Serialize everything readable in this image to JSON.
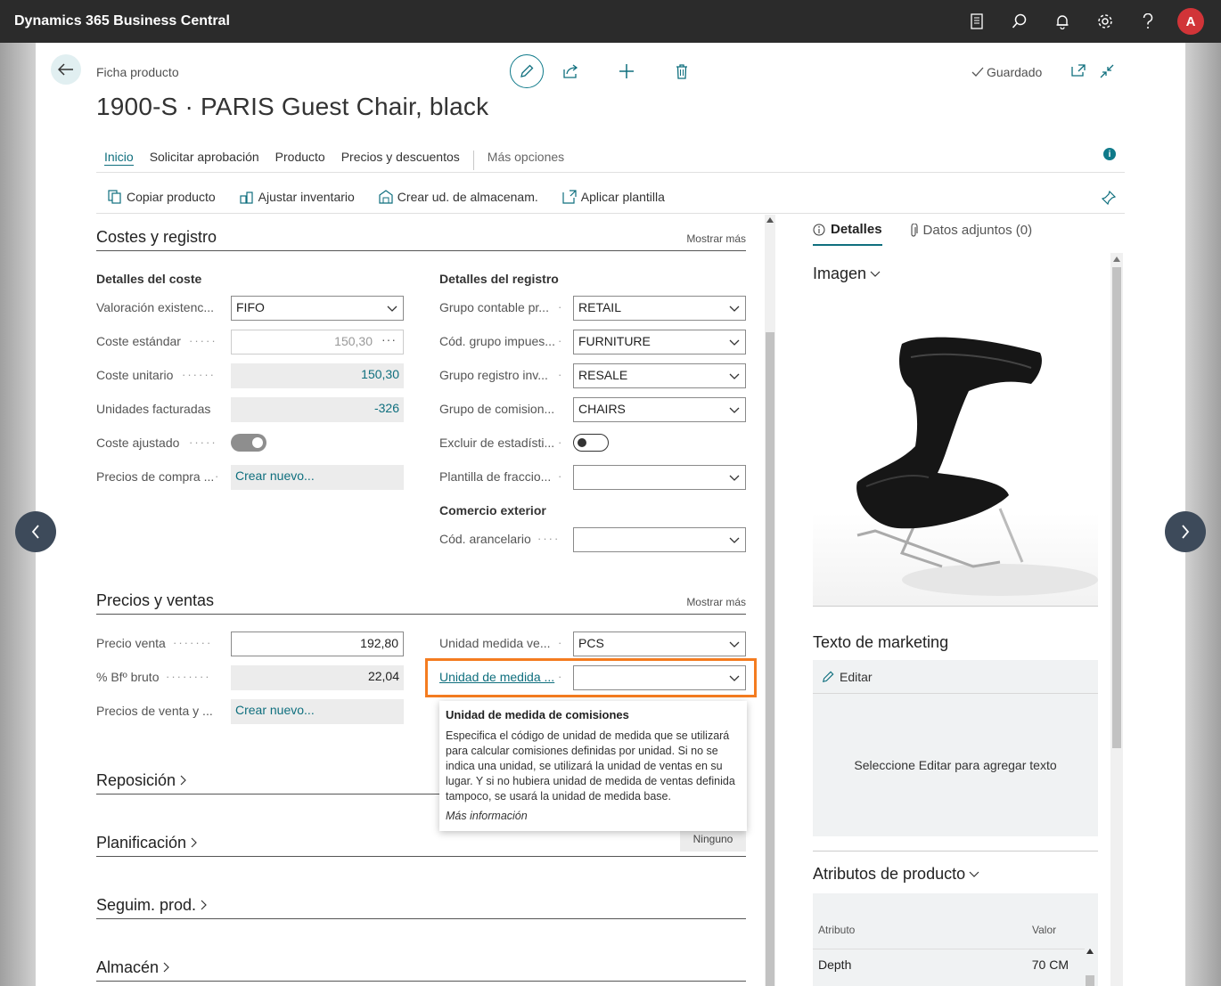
{
  "app": {
    "title": "Dynamics 365 Business Central",
    "avatar_letter": "A"
  },
  "header": {
    "breadcrumb": "Ficha producto",
    "title": "1900-S · PARIS Guest Chair, black",
    "saved": "Guardado"
  },
  "tabs": [
    "Inicio",
    "Solicitar aprobación",
    "Producto",
    "Precios y descuentos",
    "Más opciones"
  ],
  "actions": [
    "Copiar producto",
    "Ajustar inventario",
    "Crear ud. de almacenam.",
    "Aplicar plantilla"
  ],
  "costes": {
    "title": "Costes y registro",
    "more": "Mostrar más",
    "left_head": "Detalles del coste",
    "right_head": "Detalles del registro",
    "comercio_head": "Comercio exterior",
    "valoracion": {
      "label": "Valoración existenc...",
      "value": "FIFO"
    },
    "coste_estandar": {
      "label": "Coste estándar",
      "value": "150,30"
    },
    "coste_unitario": {
      "label": "Coste unitario",
      "value": "150,30"
    },
    "unidades_facturadas": {
      "label": "Unidades facturadas",
      "value": "-326"
    },
    "coste_ajustado": {
      "label": "Coste ajustado",
      "on": true
    },
    "precios_compra": {
      "label": "Precios de compra ...",
      "value": "Crear nuevo..."
    },
    "grupo_contable": {
      "label": "Grupo contable pr...",
      "value": "RETAIL"
    },
    "grupo_impuesto": {
      "label": "Cód. grupo impues...",
      "value": "FURNITURE"
    },
    "grupo_registro": {
      "label": "Grupo registro inv...",
      "value": "RESALE"
    },
    "grupo_comision": {
      "label": "Grupo de comision...",
      "value": "CHAIRS"
    },
    "excluir": {
      "label": "Excluir de estadísti...",
      "on": false
    },
    "plantilla": {
      "label": "Plantilla de fraccio...",
      "value": ""
    },
    "arancelario": {
      "label": "Cód. arancelario",
      "value": ""
    }
  },
  "precios": {
    "title": "Precios y ventas",
    "more": "Mostrar más",
    "precio_venta": {
      "label": "Precio venta",
      "value": "192,80"
    },
    "bf_bruto": {
      "label": "% Bfº bruto",
      "value": "22,04"
    },
    "precios_venta": {
      "label": "Precios de venta y ...",
      "value": "Crear nuevo..."
    },
    "unidad_venta": {
      "label": "Unidad medida ve...",
      "value": "PCS"
    },
    "unidad_comision": {
      "label": "Unidad de medida ...",
      "value": ""
    }
  },
  "tooltip": {
    "title": "Unidad de medida de comisiones",
    "body": "Especifica el código de unidad de medida que se utilizará para calcular comisiones definidas por unidad. Si no se indica una unidad, se utilizará la unidad de ventas en su lugar. Y si no hubiera unidad de medida de ventas definida tampoco, se usará la unidad de medida base.",
    "link": "Más información"
  },
  "collapsed_sections": [
    {
      "title": "Reposición"
    },
    {
      "title": "Planificación",
      "badge": "Ninguno"
    },
    {
      "title": "Seguim. prod."
    },
    {
      "title": "Almacén"
    }
  ],
  "factbox": {
    "tab_details": "Detalles",
    "tab_attachments": "Datos adjuntos (0)",
    "image_title": "Imagen",
    "marketing_title": "Texto de marketing",
    "edit_label": "Editar",
    "marketing_placeholder": "Seleccione Editar para agregar texto",
    "attributes_title": "Atributos de producto",
    "attr_col": "Atributo",
    "val_col": "Valor",
    "attr_rows": [
      {
        "name": "Depth",
        "value": "70 CM"
      }
    ]
  },
  "colors": {
    "accent": "#0f6f7e",
    "highlight": "#f47c20",
    "topbar": "#2b2b2b"
  }
}
